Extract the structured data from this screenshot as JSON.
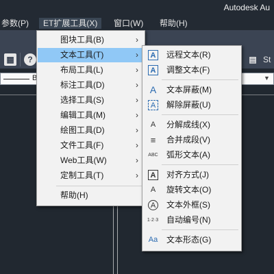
{
  "window": {
    "title": "Autodesk Au"
  },
  "menubar": {
    "items": [
      {
        "label": "参数(P)"
      },
      {
        "label": "ET扩展工具(X)"
      },
      {
        "label": "窗口(W)"
      },
      {
        "label": "帮助(H)"
      }
    ]
  },
  "toolbar": {
    "help_label": "?",
    "combo_text": "B",
    "combo_right_text": "St"
  },
  "menu_et": {
    "items": [
      {
        "label": "图块工具(B)"
      },
      {
        "label": "文本工具(T)"
      },
      {
        "label": "布局工具(L)"
      },
      {
        "label": "标注工具(D)"
      },
      {
        "label": "选择工具(S)"
      },
      {
        "label": "编辑工具(M)"
      },
      {
        "label": "绘图工具(D)"
      },
      {
        "label": "文件工具(F)"
      },
      {
        "label": "Web工具(W)"
      },
      {
        "label": "定制工具(T)"
      },
      {
        "label": "帮助(H)"
      }
    ]
  },
  "menu_text_tools": {
    "items": [
      {
        "label": "远程文本(R)",
        "icon": "remote-text-icon"
      },
      {
        "label": "调整文本(F)",
        "icon": "adjust-text-icon"
      },
      {
        "label": "文本屏蔽(M)",
        "icon": "text-mask-icon"
      },
      {
        "label": "解除屏蔽(U)",
        "icon": "unmask-text-icon"
      },
      {
        "label": "分解成线(X)",
        "icon": "explode-text-icon"
      },
      {
        "label": "合并成段(V)",
        "icon": "merge-text-icon"
      },
      {
        "label": "弧形文本(A)",
        "icon": "arc-text-icon"
      },
      {
        "label": "对齐方式(J)",
        "icon": "align-text-icon"
      },
      {
        "label": "旋转文本(O)",
        "icon": "rotate-text-icon"
      },
      {
        "label": "文本外框(S)",
        "icon": "text-frame-icon"
      },
      {
        "label": "自动编号(N)",
        "icon": "auto-number-icon"
      },
      {
        "label": "文本形态(G)",
        "icon": "text-case-icon"
      }
    ],
    "icon_glyphs": {
      "remote": "A",
      "adjust": "A",
      "mask": "A",
      "unmask": "A",
      "explode": "A",
      "merge": "≡",
      "arc": "ABC",
      "align": "A",
      "rotate": "A",
      "frame": "A",
      "number": "1·2·3",
      "case": "Aa"
    }
  },
  "colors": {
    "accent": "#90c8f6",
    "icon_blue": "#2a6ab0",
    "background": "#212830",
    "toolbar": "#3b4453"
  }
}
